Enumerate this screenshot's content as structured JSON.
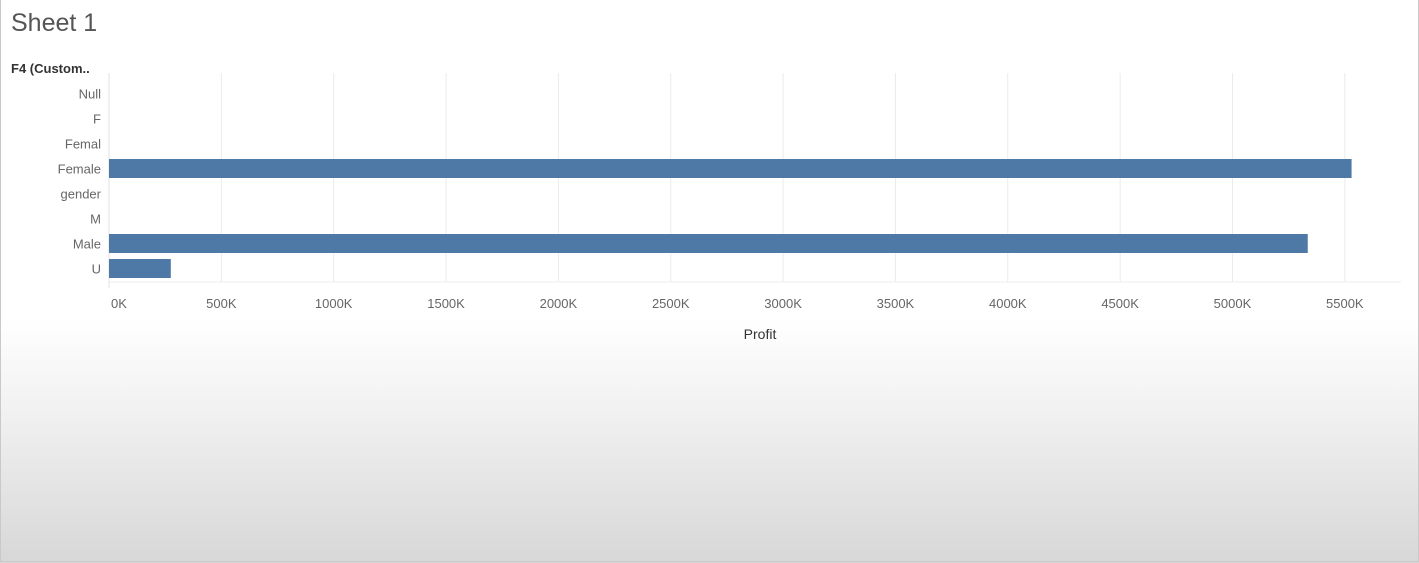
{
  "sheet": {
    "title": "Sheet 1",
    "row_header": "F4 (Custom.."
  },
  "colors": {
    "bar": "#4e79a7",
    "grid": "#ebebeb"
  },
  "chart_data": {
    "type": "bar",
    "orientation": "horizontal",
    "categories": [
      "Null",
      "F",
      "Femal",
      "Female",
      "gender",
      "M",
      "Male",
      "U"
    ],
    "values": [
      0,
      0,
      0,
      5530000,
      0,
      0,
      5335000,
      275000
    ],
    "xlabel": "Profit",
    "ylabel": "F4 (Custom..",
    "xlim": [
      0,
      5750000
    ],
    "xticks": [
      0,
      500000,
      1000000,
      1500000,
      2000000,
      2500000,
      3000000,
      3500000,
      4000000,
      4500000,
      5000000,
      5500000
    ],
    "xtick_labels": [
      "0K",
      "500K",
      "1000K",
      "1500K",
      "2000K",
      "2500K",
      "3000K",
      "3500K",
      "4000K",
      "4500K",
      "5000K",
      "5500K"
    ],
    "grid": true
  }
}
